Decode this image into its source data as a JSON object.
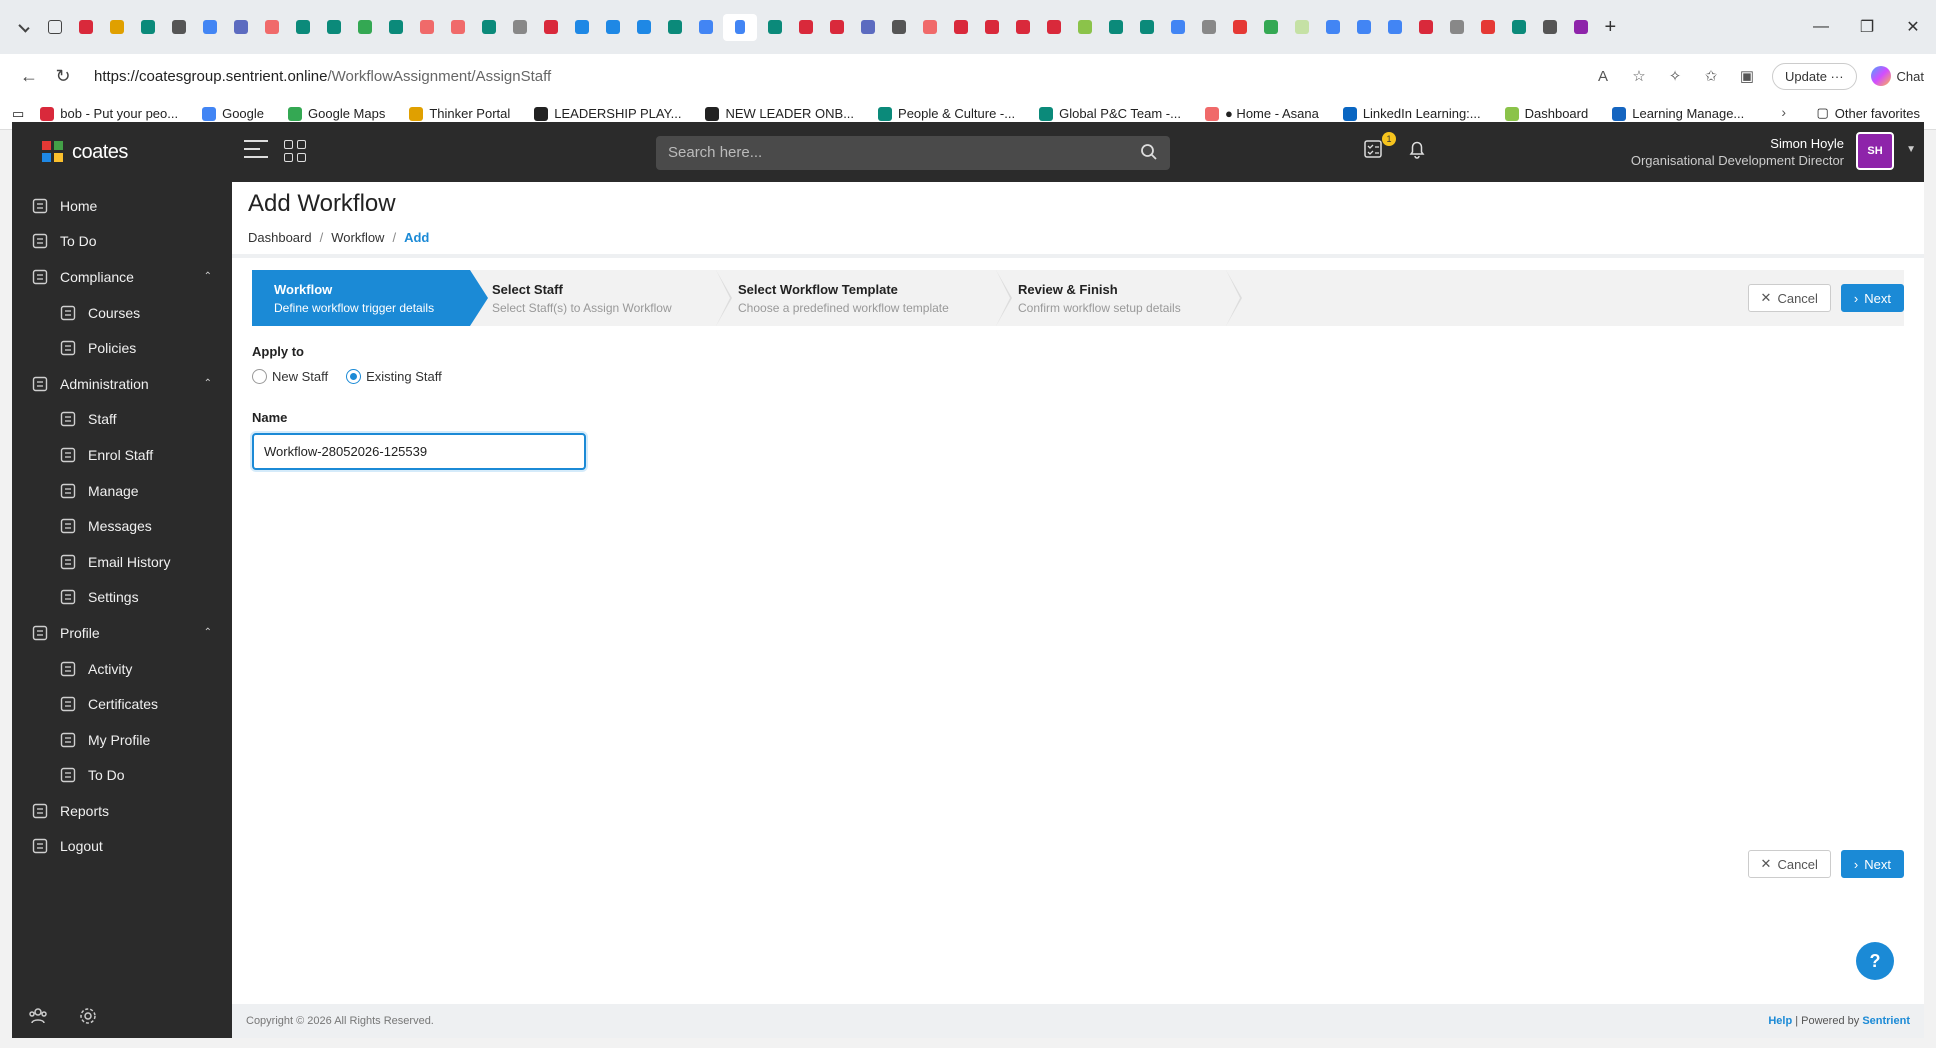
{
  "browser": {
    "url_host": "https://coatesgroup.sentrient.online",
    "url_path": "/WorkflowAssignment/AssignStaff",
    "update_label": "Update",
    "chat_label": "Chat",
    "favorites": [
      {
        "label": "bob - Put your peo...",
        "color": "#d9293b"
      },
      {
        "label": "Google",
        "color": "#4285f4"
      },
      {
        "label": "Google Maps",
        "color": "#34a853"
      },
      {
        "label": "Thinker Portal",
        "color": "#e0a000"
      },
      {
        "label": "LEADERSHIP PLAY...",
        "color": "#222222"
      },
      {
        "label": "NEW LEADER ONB...",
        "color": "#222222"
      },
      {
        "label": "People & Culture -...",
        "color": "#0b8a7a"
      },
      {
        "label": "Global P&C Team -...",
        "color": "#0b8a7a"
      },
      {
        "label": "● Home - Asana",
        "color": "#f06a6a"
      },
      {
        "label": "LinkedIn Learning:...",
        "color": "#0a66c2"
      },
      {
        "label": "Dashboard",
        "color": "#8bc34a"
      },
      {
        "label": "Learning Manage...",
        "color": "#1565c0"
      }
    ],
    "other_favorites": "Other favorites"
  },
  "app": {
    "logo_text": "coates",
    "search_placeholder": "Search here...",
    "notification_count": "1",
    "user_name": "Simon Hoyle",
    "user_role": "Organisational Development Director",
    "user_initials": "SH"
  },
  "sidebar": {
    "items": [
      {
        "label": "Home",
        "icon": "home-icon",
        "level": 0
      },
      {
        "label": "To Do",
        "icon": "checklist-icon",
        "level": 0
      },
      {
        "label": "Compliance",
        "icon": "compliance-icon",
        "level": 0,
        "expanded": true
      },
      {
        "label": "Courses",
        "icon": "courses-icon",
        "level": 1
      },
      {
        "label": "Policies",
        "icon": "policies-icon",
        "level": 1
      },
      {
        "label": "Administration",
        "icon": "users-icon",
        "level": 0,
        "expanded": true
      },
      {
        "label": "Staff",
        "icon": "staff-icon",
        "level": 1
      },
      {
        "label": "Enrol Staff",
        "icon": "enrol-icon",
        "level": 1
      },
      {
        "label": "Manage",
        "icon": "manage-icon",
        "level": 1
      },
      {
        "label": "Messages",
        "icon": "messages-icon",
        "level": 1
      },
      {
        "label": "Email History",
        "icon": "email-history-icon",
        "level": 1
      },
      {
        "label": "Settings",
        "icon": "gear-icon",
        "level": 1
      },
      {
        "label": "Profile",
        "icon": "profile-icon",
        "level": 0,
        "expanded": true
      },
      {
        "label": "Activity",
        "icon": "activity-icon",
        "level": 1
      },
      {
        "label": "Certificates",
        "icon": "certificate-icon",
        "level": 1
      },
      {
        "label": "My Profile",
        "icon": "my-profile-icon",
        "level": 1
      },
      {
        "label": "To Do",
        "icon": "checklist-icon",
        "level": 1
      },
      {
        "label": "Reports",
        "icon": "reports-icon",
        "level": 0
      },
      {
        "label": "Logout",
        "icon": "logout-icon",
        "level": 0
      }
    ]
  },
  "page": {
    "title": "Add Workflow",
    "breadcrumb": [
      "Dashboard",
      "Workflow",
      "Add"
    ],
    "steps": [
      {
        "title": "Workflow",
        "desc": "Define workflow trigger details",
        "active": true
      },
      {
        "title": "Select Staff",
        "desc": "Select Staff(s) to Assign Workflow",
        "active": false
      },
      {
        "title": "Select Workflow Template",
        "desc": "Choose a predefined workflow template",
        "active": false
      },
      {
        "title": "Review & Finish",
        "desc": "Confirm workflow setup details",
        "active": false
      }
    ],
    "cancel_label": "Cancel",
    "next_label": "Next",
    "apply_to_label": "Apply to",
    "apply_options": [
      {
        "label": "New Staff",
        "selected": false
      },
      {
        "label": "Existing Staff",
        "selected": true
      }
    ],
    "name_label": "Name",
    "name_value": "Workflow-28052026-125539",
    "help_fab": "?"
  },
  "footer": {
    "copyright": "Copyright © 2026 All Rights Reserved.",
    "help": "Help",
    "powered_prefix": "| Powered by",
    "powered_brand": "Sentrient"
  },
  "colors": {
    "accent": "#1b8ad6",
    "sidebar": "#2b2b2b",
    "avatar": "#8e24aa"
  }
}
